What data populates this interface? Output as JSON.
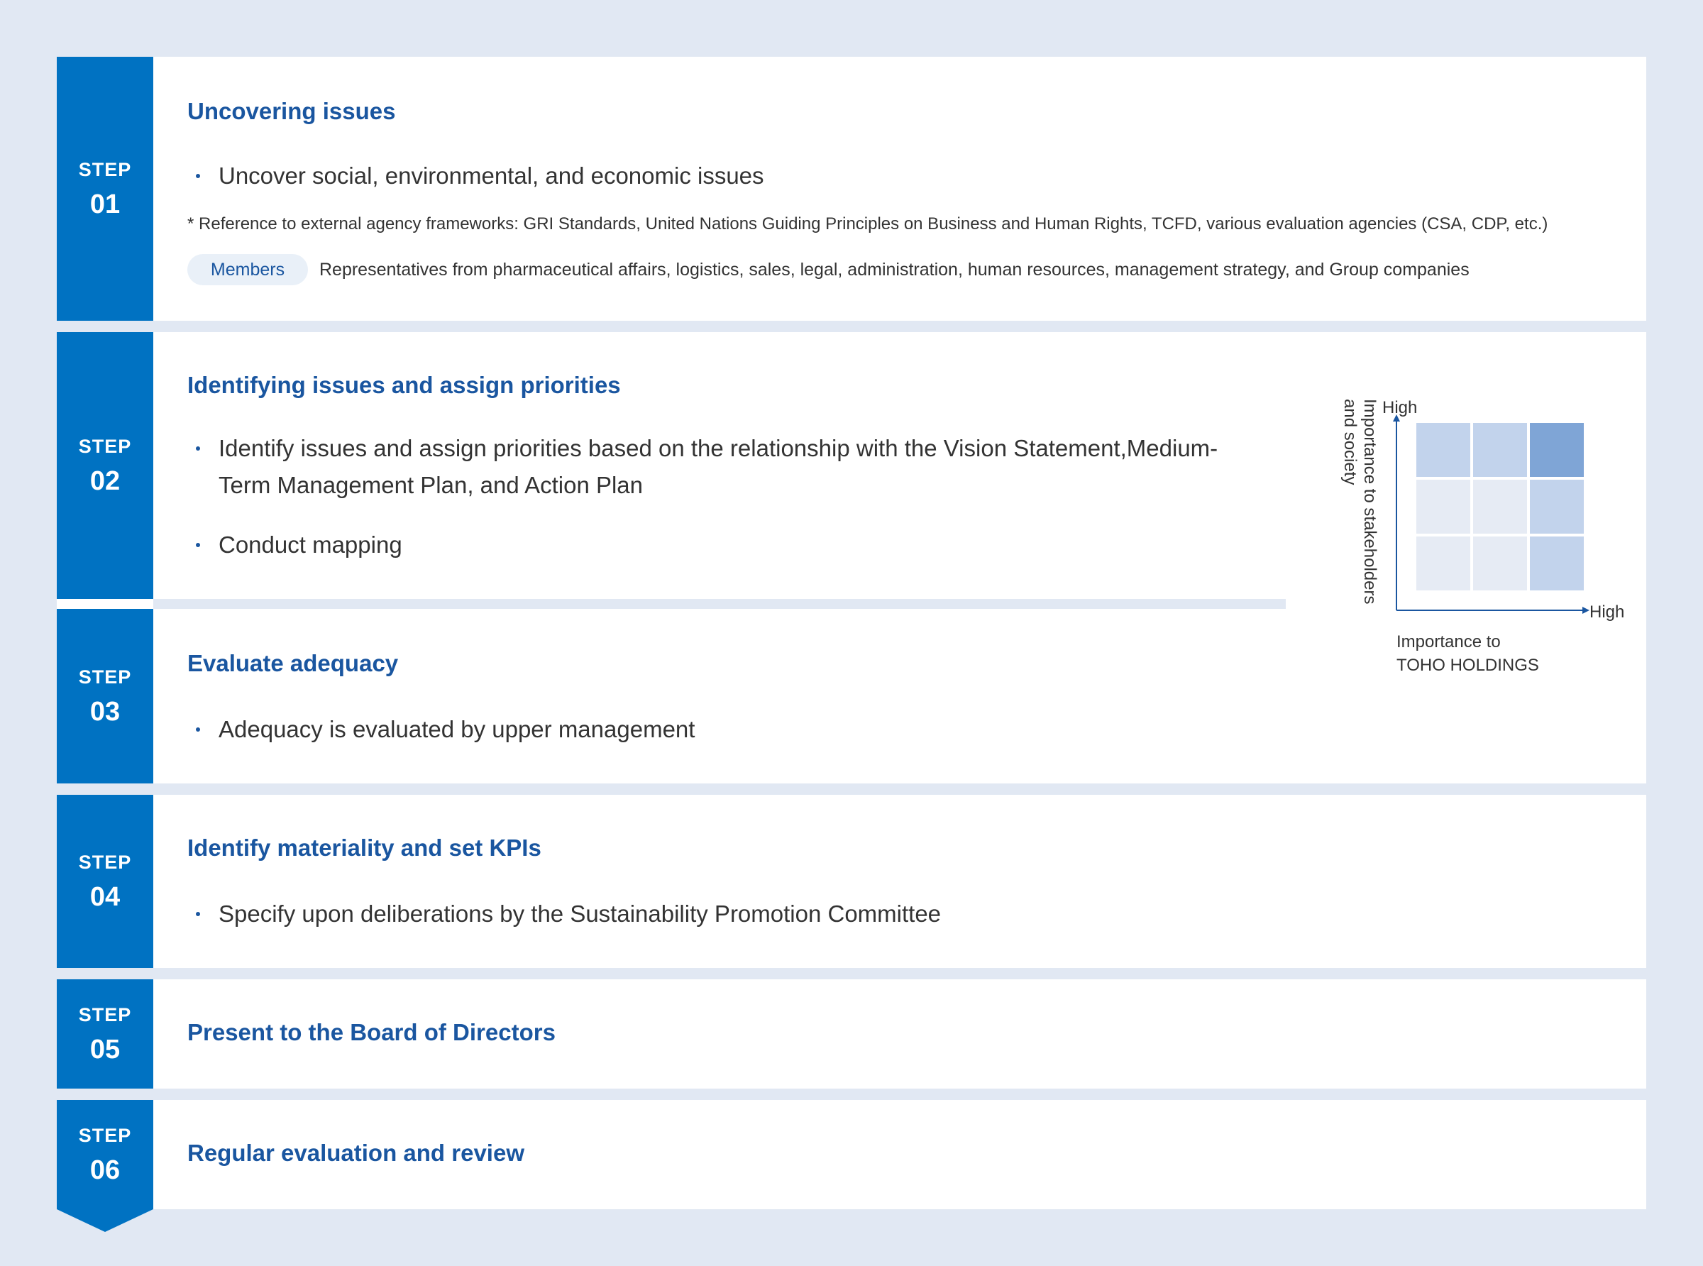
{
  "steps": [
    {
      "word": "STEP",
      "num": "01",
      "title": "Uncovering issues",
      "bullets": [
        "Uncover social, environmental, and economic issues"
      ],
      "note": "*  Reference to external agency frameworks: GRI Standards, United Nations Guiding Principles on Business and Human Rights, TCFD, various evaluation agencies (CSA, CDP, etc.)",
      "members_label": "Members",
      "members_text": "Representatives from pharmaceutical affairs, logistics, sales, legal, administration, human resources, management strategy, and Group companies"
    },
    {
      "word": "STEP",
      "num": "02",
      "title": "Identifying issues and assign priorities",
      "bullets": [
        "Identify issues and assign priorities based on the relationship with the Vision Statement,Medium-Term Management Plan, and Action Plan",
        "Conduct mapping"
      ]
    },
    {
      "word": "STEP",
      "num": "03",
      "title": "Evaluate adequacy",
      "bullets": [
        "Adequacy is evaluated by upper management"
      ]
    },
    {
      "word": "STEP",
      "num": "04",
      "title": "Identify materiality and set KPIs",
      "bullets": [
        "Specify upon deliberations by the Sustainability Promotion Committee"
      ]
    },
    {
      "word": "STEP",
      "num": "05",
      "title": "Present to the Board of Directors"
    },
    {
      "word": "STEP",
      "num": "06",
      "title": "Regular evaluation and review"
    }
  ],
  "matrix": {
    "y_axis_label_line1": "Importance to stakeholders",
    "y_axis_label_line2": "and society",
    "y_high": "High",
    "x_high": "High",
    "x_axis_label_line1": "Importance to",
    "x_axis_label_line2": "TOHO HOLDINGS",
    "cell_levels": [
      [
        1,
        1,
        2
      ],
      [
        0,
        0,
        1
      ],
      [
        0,
        0,
        1
      ]
    ],
    "colors": {
      "level0": "#e6ebf4",
      "level1": "#c2d3ec",
      "level2": "#7fa5d6",
      "axis": "#1a56a0"
    }
  }
}
